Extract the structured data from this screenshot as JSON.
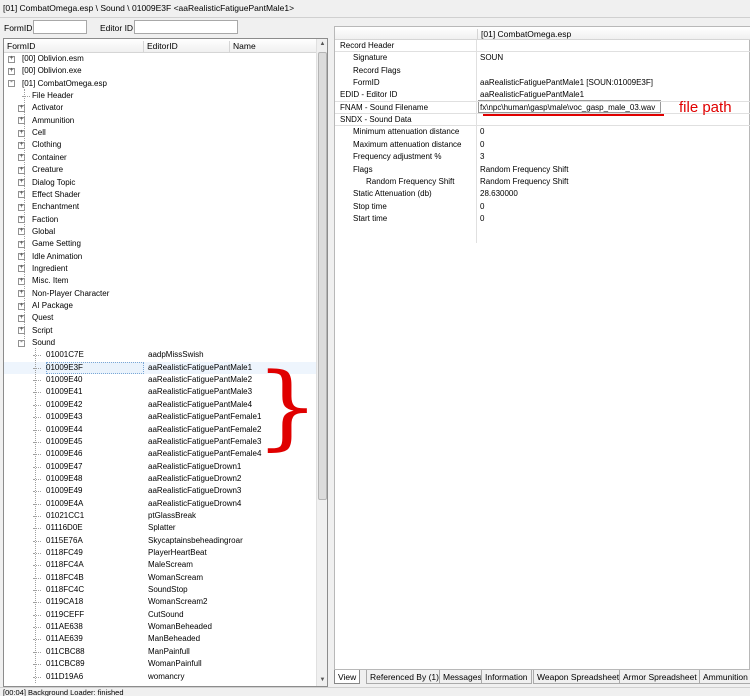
{
  "window": {
    "title": "[01] CombatOmega.esp \\ Sound \\ 01009E3F <aaRealisticFatiguePantMale1>"
  },
  "filter": {
    "formid_label": "FormID",
    "editorid_label": "Editor ID",
    "formid_value": "",
    "editorid_value": ""
  },
  "left_panel": {
    "columns": [
      "FormID",
      "EditorID",
      "Name"
    ],
    "tree": [
      {
        "level": 0,
        "exp": "+",
        "text": "[00] Oblivion.esm"
      },
      {
        "level": 0,
        "exp": "+",
        "text": "[00] Oblivion.exe"
      },
      {
        "level": 0,
        "exp": "-",
        "text": "[01] CombatOmega.esp"
      },
      {
        "level": 1,
        "exp": "",
        "text": "File Header"
      },
      {
        "level": 1,
        "exp": "+",
        "text": "Activator"
      },
      {
        "level": 1,
        "exp": "+",
        "text": "Ammunition"
      },
      {
        "level": 1,
        "exp": "+",
        "text": "Cell"
      },
      {
        "level": 1,
        "exp": "+",
        "text": "Clothing"
      },
      {
        "level": 1,
        "exp": "+",
        "text": "Container"
      },
      {
        "level": 1,
        "exp": "+",
        "text": "Creature"
      },
      {
        "level": 1,
        "exp": "+",
        "text": "Dialog Topic"
      },
      {
        "level": 1,
        "exp": "+",
        "text": "Effect Shader"
      },
      {
        "level": 1,
        "exp": "+",
        "text": "Enchantment"
      },
      {
        "level": 1,
        "exp": "+",
        "text": "Faction"
      },
      {
        "level": 1,
        "exp": "+",
        "text": "Global"
      },
      {
        "level": 1,
        "exp": "+",
        "text": "Game Setting"
      },
      {
        "level": 1,
        "exp": "+",
        "text": "Idle Animation"
      },
      {
        "level": 1,
        "exp": "+",
        "text": "Ingredient"
      },
      {
        "level": 1,
        "exp": "+",
        "text": "Misc. Item"
      },
      {
        "level": 1,
        "exp": "+",
        "text": "Non-Player Character"
      },
      {
        "level": 1,
        "exp": "+",
        "text": "AI Package"
      },
      {
        "level": 1,
        "exp": "+",
        "text": "Quest"
      },
      {
        "level": 1,
        "exp": "+",
        "text": "Script"
      },
      {
        "level": 1,
        "exp": "-",
        "text": "Sound"
      },
      {
        "level": 2,
        "exp": "",
        "text": "01001C7E",
        "editor": "aadpMissSwish"
      },
      {
        "level": 2,
        "exp": "",
        "text": "01009E3F",
        "editor": "aaRealisticFatiguePantMale1",
        "selected": true
      },
      {
        "level": 2,
        "exp": "",
        "text": "01009E40",
        "editor": "aaRealisticFatiguePantMale2"
      },
      {
        "level": 2,
        "exp": "",
        "text": "01009E41",
        "editor": "aaRealisticFatiguePantMale3"
      },
      {
        "level": 2,
        "exp": "",
        "text": "01009E42",
        "editor": "aaRealisticFatiguePantMale4"
      },
      {
        "level": 2,
        "exp": "",
        "text": "01009E43",
        "editor": "aaRealisticFatiguePantFemale1"
      },
      {
        "level": 2,
        "exp": "",
        "text": "01009E44",
        "editor": "aaRealisticFatiguePantFemale2"
      },
      {
        "level": 2,
        "exp": "",
        "text": "01009E45",
        "editor": "aaRealisticFatiguePantFemale3"
      },
      {
        "level": 2,
        "exp": "",
        "text": "01009E46",
        "editor": "aaRealisticFatiguePantFemale4"
      },
      {
        "level": 2,
        "exp": "",
        "text": "01009E47",
        "editor": "aaRealisticFatigueDrown1"
      },
      {
        "level": 2,
        "exp": "",
        "text": "01009E48",
        "editor": "aaRealisticFatigueDrown2"
      },
      {
        "level": 2,
        "exp": "",
        "text": "01009E49",
        "editor": "aaRealisticFatigueDrown3"
      },
      {
        "level": 2,
        "exp": "",
        "text": "01009E4A",
        "editor": "aaRealisticFatigueDrown4"
      },
      {
        "level": 2,
        "exp": "",
        "text": "01021CC1",
        "editor": "ptGlassBreak"
      },
      {
        "level": 2,
        "exp": "",
        "text": "01116D0E",
        "editor": "Splatter"
      },
      {
        "level": 2,
        "exp": "",
        "text": "0115E76A",
        "editor": "Skycaptainsbeheadingroar"
      },
      {
        "level": 2,
        "exp": "",
        "text": "0118FC49",
        "editor": "PlayerHeartBeat"
      },
      {
        "level": 2,
        "exp": "",
        "text": "0118FC4A",
        "editor": "MaleScream"
      },
      {
        "level": 2,
        "exp": "",
        "text": "0118FC4B",
        "editor": "WomanScream"
      },
      {
        "level": 2,
        "exp": "",
        "text": "0118FC4C",
        "editor": "SoundStop"
      },
      {
        "level": 2,
        "exp": "",
        "text": "0119CA18",
        "editor": "WomanScream2"
      },
      {
        "level": 2,
        "exp": "",
        "text": "0119CEFF",
        "editor": "CutSound"
      },
      {
        "level": 2,
        "exp": "",
        "text": "011AE638",
        "editor": "WomanBeheaded"
      },
      {
        "level": 2,
        "exp": "",
        "text": "011AE639",
        "editor": "ManBeheaded"
      },
      {
        "level": 2,
        "exp": "",
        "text": "011CBC88",
        "editor": "ManPainfull"
      },
      {
        "level": 2,
        "exp": "",
        "text": "011CBC89",
        "editor": "WomanPainfull"
      },
      {
        "level": 2,
        "exp": "",
        "text": "011D19A6",
        "editor": "womancry"
      }
    ]
  },
  "right_panel": {
    "header": "[01] CombatOmega.esp",
    "rows": [
      {
        "indent": 0,
        "key": "Record Header",
        "value": ""
      },
      {
        "indent": 1,
        "key": "Signature",
        "value": "SOUN"
      },
      {
        "indent": 1,
        "key": "Record Flags",
        "value": ""
      },
      {
        "indent": 1,
        "key": "FormID",
        "value": "aaRealisticFatiguePantMale1 [SOUN:01009E3F]"
      },
      {
        "indent": 0,
        "key": "EDID - Editor ID",
        "value": "aaRealisticFatiguePantMale1"
      },
      {
        "indent": 0,
        "key": "FNAM - Sound Filename",
        "value": "fx\\npc\\human\\gasp\\male\\voc_gasp_male_03.wav"
      },
      {
        "indent": 0,
        "key": "SNDX - Sound Data",
        "value": ""
      },
      {
        "indent": 1,
        "key": "Minimum attenuation distance",
        "value": "0"
      },
      {
        "indent": 1,
        "key": "Maximum attenuation distance",
        "value": "0"
      },
      {
        "indent": 1,
        "key": "Frequency adjustment %",
        "value": "3"
      },
      {
        "indent": 1,
        "key": "Flags",
        "value": "Random Frequency Shift"
      },
      {
        "indent": 2,
        "key": "Random Frequency Shift",
        "value": "Random Frequency Shift"
      },
      {
        "indent": 1,
        "key": "Static Attenuation (db)",
        "value": "28.630000"
      },
      {
        "indent": 1,
        "key": "Stop time",
        "value": "0"
      },
      {
        "indent": 1,
        "key": "Start time",
        "value": "0"
      }
    ],
    "annotation": "file path"
  },
  "tabs": [
    "View",
    "Referenced By (1)",
    "Messages",
    "Information",
    "Weapon Spreadsheet",
    "Armor Spreadsheet",
    "Ammunition S"
  ],
  "status": "[00:04] Background Loader: finished",
  "colors": {
    "annotation": "#e00000",
    "selection": "#eaf3fc"
  }
}
